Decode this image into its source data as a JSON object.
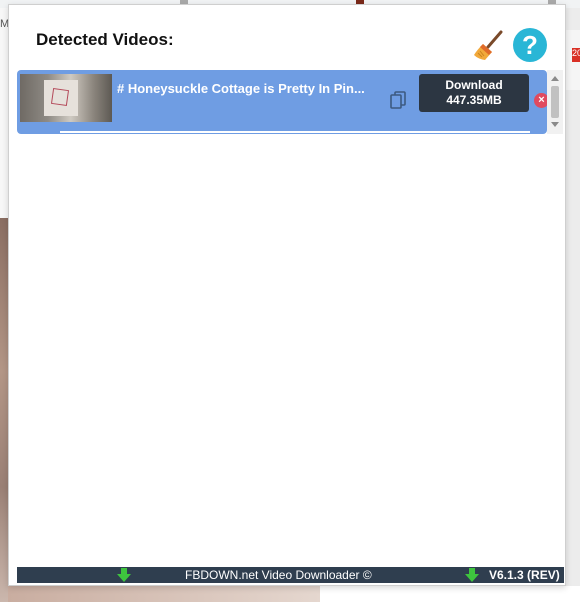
{
  "background": {
    "left_letter": "M",
    "right_badge": "20"
  },
  "header": {
    "title": "Detected Videos:",
    "clear_icon": "broom-icon",
    "help_icon": "question-icon",
    "help_label": "?"
  },
  "videos": [
    {
      "title": "# Honeysuckle Cottage is Pretty In Pin...",
      "thumbnail_icon": "video-thumbnail",
      "copy_icon": "copy-icon",
      "download_label": "Download",
      "size": "447.35MB",
      "remove_label": "×"
    }
  ],
  "footer": {
    "brand": "FBDOWN.net Video Downloader ©",
    "version": "V6.1.3 (REV)",
    "arrow_icon": "download-arrow-icon"
  },
  "colors": {
    "row_bg": "#6f9de3",
    "button_bg": "#2c3642",
    "help_bg": "#29b6d6",
    "remove_bg": "#e04a5f",
    "footer_bg": "#2f3e4f",
    "arrow_green": "#3ec43e"
  }
}
